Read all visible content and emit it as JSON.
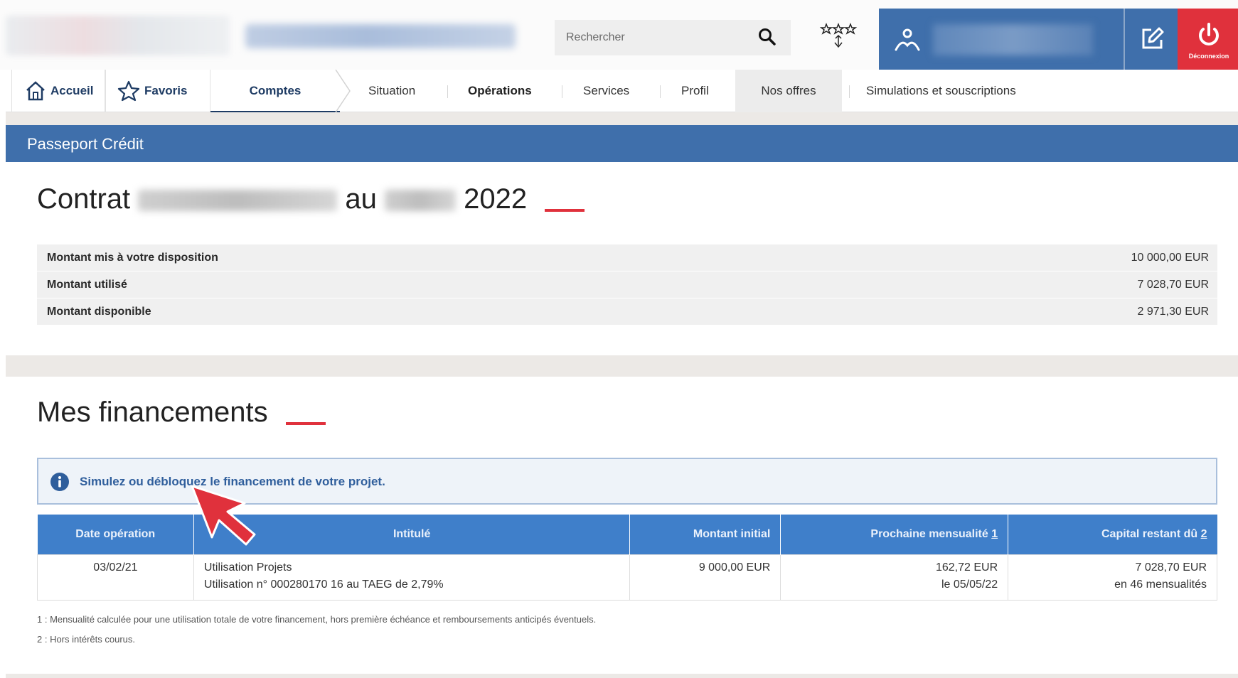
{
  "header": {
    "search_placeholder": "Rechercher",
    "logout_label": "Déconnexion"
  },
  "nav": {
    "home": "Accueil",
    "favorites": "Favoris",
    "accounts": "Comptes",
    "situation": "Situation",
    "operations": "Opérations",
    "services": "Services",
    "profile": "Profil",
    "offers": "Nos offres",
    "simulations": "Simulations et souscriptions"
  },
  "section": {
    "title": "Passeport Crédit"
  },
  "contract": {
    "title_prefix": "Contrat",
    "title_middle": "au",
    "title_year": "2022",
    "rows": [
      {
        "label": "Montant mis à votre disposition",
        "value": "10 000,00 EUR"
      },
      {
        "label": "Montant utilisé",
        "value": "7 028,70 EUR"
      },
      {
        "label": "Montant disponible",
        "value": "2 971,30 EUR"
      }
    ]
  },
  "financements": {
    "title": "Mes financements",
    "info_text": "Simulez ou débloquez le financement de votre projet.",
    "columns": {
      "date": "Date opération",
      "label": "Intitulé",
      "initial": "Montant initial",
      "next": "Prochaine mensualité",
      "next_ref": "1",
      "capital": "Capital restant dû",
      "capital_ref": "2"
    },
    "rows": [
      {
        "date": "03/02/21",
        "label_line1": "Utilisation Projets",
        "label_line2": "Utilisation n° 000280170 16 au TAEG de 2,79%",
        "initial": "9 000,00 EUR",
        "next_amount": "162,72 EUR",
        "next_date": "le 05/05/22",
        "capital_amount": "7 028,70 EUR",
        "capital_detail": "en 46 mensualités"
      }
    ],
    "footnote1": "1 : Mensualité calculée pour une utilisation totale de votre financement, hors première échéance et remboursements anticipés éventuels.",
    "footnote2": "2 : Hors intérêts courus."
  },
  "colors": {
    "primary_blue": "#3f6fab",
    "table_header_blue": "#3f7fca",
    "accent_red": "#e0313c"
  }
}
